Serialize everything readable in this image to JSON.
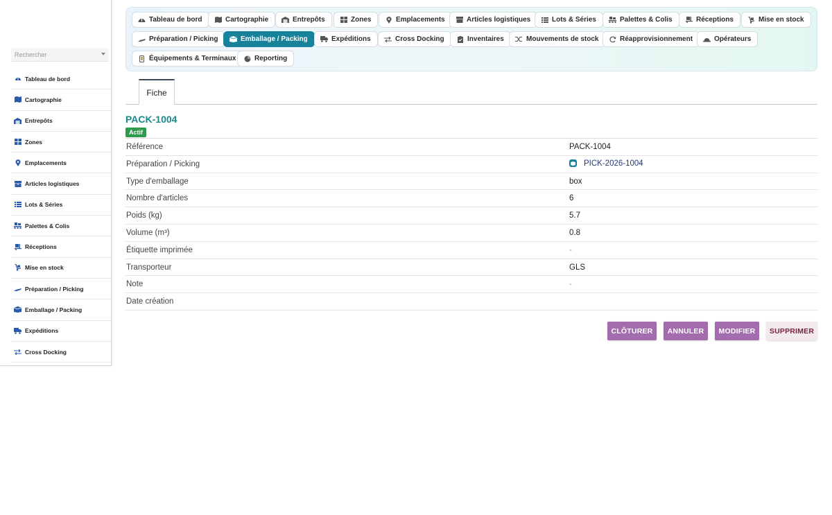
{
  "sidebar": {
    "search_placeholder": "Rechercher",
    "items": [
      {
        "label": "Tableau de bord",
        "icon": "dashboard-icon"
      },
      {
        "label": "Cartographie",
        "icon": "map-icon"
      },
      {
        "label": "Entrepôts",
        "icon": "warehouse-icon"
      },
      {
        "label": "Zones",
        "icon": "grid-icon"
      },
      {
        "label": "Emplacements",
        "icon": "location-pin-icon"
      },
      {
        "label": "Articles logistiques",
        "icon": "box-icon"
      },
      {
        "label": "Lots & Séries",
        "icon": "list-icon"
      },
      {
        "label": "Palettes & Colis",
        "icon": "pallet-icon"
      },
      {
        "label": "Réceptions",
        "icon": "dolly-icon"
      },
      {
        "label": "Mise en stock",
        "icon": "hand-truck-icon"
      },
      {
        "label": "Préparation / Picking",
        "icon": "picking-icon"
      },
      {
        "label": "Emballage / Packing",
        "icon": "packing-icon"
      },
      {
        "label": "Expéditions",
        "icon": "truck-icon"
      },
      {
        "label": "Cross Docking",
        "icon": "arrows-exchange-icon"
      }
    ]
  },
  "topnav": {
    "items": [
      {
        "label": "Tableau de bord"
      },
      {
        "label": "Cartographie"
      },
      {
        "label": "Entrepôts"
      },
      {
        "label": "Zones"
      },
      {
        "label": "Emplacements"
      },
      {
        "label": "Articles logistiques"
      },
      {
        "label": "Lots & Séries"
      },
      {
        "label": "Palettes & Colis"
      },
      {
        "label": "Réceptions"
      },
      {
        "label": "Mise en stock"
      },
      {
        "label": "Préparation / Picking"
      },
      {
        "label": "Emballage / Packing"
      },
      {
        "label": "Expéditions"
      },
      {
        "label": "Cross Docking"
      },
      {
        "label": "Inventaires"
      },
      {
        "label": "Mouvements de stock"
      },
      {
        "label": "Réapprovisionnement"
      },
      {
        "label": "Opérateurs"
      },
      {
        "label": "Équipements & Terminaux"
      },
      {
        "label": "Reporting"
      }
    ],
    "active": "Emballage / Packing"
  },
  "tabs": {
    "fiche": "Fiche"
  },
  "record": {
    "title": "PACK-1004",
    "status": "Actif",
    "fields": [
      {
        "label": "Référence",
        "value": "PACK-1004"
      },
      {
        "label": "Préparation / Picking",
        "value": "PICK-2026-1004"
      },
      {
        "label": "Type d'emballage",
        "value": "box"
      },
      {
        "label": "Nombre d'articles",
        "value": "6"
      },
      {
        "label": "Poids (kg)",
        "value": "5.7"
      },
      {
        "label": "Volume (m³)",
        "value": "0.8"
      },
      {
        "label": "Étiquette imprimée",
        "value": "-"
      },
      {
        "label": "Transporteur",
        "value": "GLS"
      },
      {
        "label": "Note",
        "value": "-"
      },
      {
        "label": "Date création",
        "value": ""
      }
    ]
  },
  "actions": {
    "close": "CLÔTURER",
    "cancel": "ANNULER",
    "edit": "MODIFIER",
    "delete": "SUPPRIMER"
  },
  "colors": {
    "accent": "#17829a",
    "title": "#188a8c",
    "status": "#2e9a4c",
    "action": "#a36cac",
    "danger_text": "#7a2340"
  }
}
